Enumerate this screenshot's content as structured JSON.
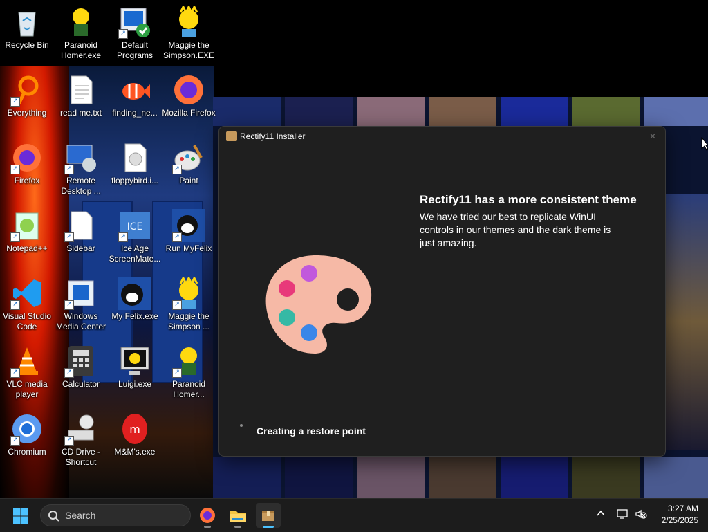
{
  "desktop": {
    "icons": [
      {
        "label": "Recycle Bin"
      },
      {
        "label": "Paranoid Homer.exe"
      },
      {
        "label": "Default Programs"
      },
      {
        "label": "Maggie the Simpson.EXE"
      },
      {
        "label": "Everything"
      },
      {
        "label": "read me.txt"
      },
      {
        "label": "finding_ne..."
      },
      {
        "label": "Mozilla Firefox"
      },
      {
        "label": "Firefox"
      },
      {
        "label": "Remote Desktop ..."
      },
      {
        "label": "floppybird.i..."
      },
      {
        "label": "Paint"
      },
      {
        "label": "Notepad++"
      },
      {
        "label": "Sidebar"
      },
      {
        "label": "Ice Age ScreenMate..."
      },
      {
        "label": "Run MyFelix"
      },
      {
        "label": "Visual Studio Code"
      },
      {
        "label": "Windows Media Center"
      },
      {
        "label": "My Felix.exe"
      },
      {
        "label": "Maggie the Simpson ..."
      },
      {
        "label": "VLC media player"
      },
      {
        "label": "Calculator"
      },
      {
        "label": "Luigi.exe"
      },
      {
        "label": "Paranoid Homer..."
      },
      {
        "label": "Chromium"
      },
      {
        "label": "CD Drive - Shortcut"
      },
      {
        "label": "M&M's.exe"
      }
    ]
  },
  "installer": {
    "title": "Rectify11 Installer",
    "headline": "Rectify11 has a more consistent theme",
    "description": "We have tried our best to replicate WinUI controls in our themes and the dark theme is just amazing.",
    "status": "Creating a restore point",
    "close_icon": "close-icon"
  },
  "taskbar": {
    "search_placeholder": "Search",
    "clock_time": "3:27 AM",
    "clock_date": "2/25/2025",
    "accent": "#4cc2ff"
  }
}
